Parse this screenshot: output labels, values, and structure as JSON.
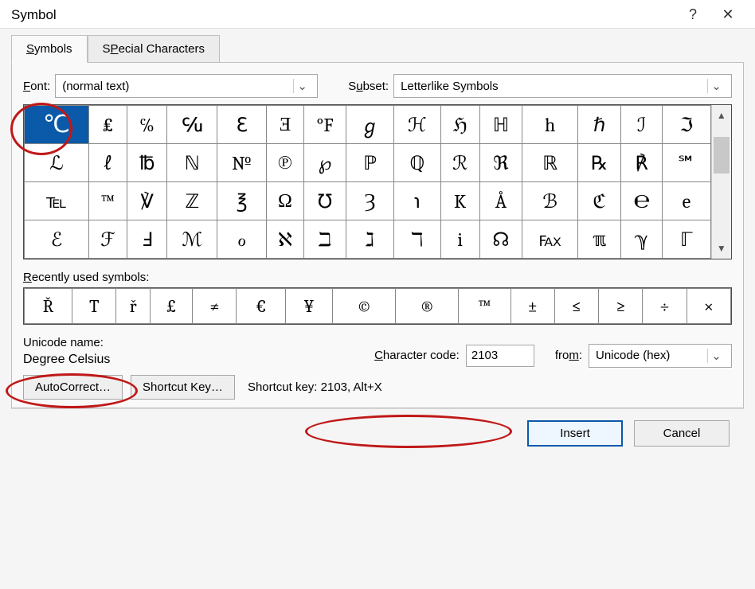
{
  "title": "Symbol",
  "help_glyph": "?",
  "close_glyph": "✕",
  "tabs": [
    {
      "label": "Symbols",
      "underline": "S",
      "rest": "ymbols",
      "active": true
    },
    {
      "label": "Special Characters",
      "underline": "P",
      "before": "S",
      "rest": "ecial Characters",
      "active": false
    }
  ],
  "font": {
    "label_before": "",
    "label_underline": "F",
    "label_after": "ont:",
    "value": "(normal text)"
  },
  "subset": {
    "label_before": "S",
    "label_underline": "u",
    "label_after": "bset:",
    "value": "Letterlike Symbols"
  },
  "grid": [
    [
      "℃",
      "₤",
      "℅",
      "℆",
      "ℇ",
      "Ǝ",
      "°F",
      "ℊ",
      "ℋ",
      "ℌ",
      "ℍ",
      "h",
      "ℏ",
      "ℐ",
      "ℑ"
    ],
    [
      "ℒ",
      "ℓ",
      "℔",
      "ℕ",
      "№",
      "℗",
      "℘",
      "ℙ",
      "ℚ",
      "ℛ",
      "ℜ",
      "ℝ",
      "℞",
      "℟",
      "℠"
    ],
    [
      "℡",
      "™",
      "℣",
      "ℤ",
      "℥",
      "Ω",
      "℧",
      "Ȝ",
      "℩",
      "K",
      "Å",
      "ℬ",
      "ℭ",
      "℮",
      "e"
    ],
    [
      "ℰ",
      "ℱ",
      "Ⅎ",
      "ℳ",
      "ℴ",
      "ℵ",
      "ℶ",
      "ℷ",
      "ℸ",
      "i",
      "☊",
      "℻",
      "ℼ",
      "ℽ",
      "ℾ"
    ]
  ],
  "selected": {
    "row": 0,
    "col": 0
  },
  "recent": {
    "label_underline": "R",
    "label_rest": "ecently used symbols:",
    "items": [
      "Ř",
      "T",
      "ř",
      "£",
      "≠",
      "€",
      "¥",
      "©",
      "®",
      "™",
      "±",
      "≤",
      "≥",
      "÷",
      "×"
    ]
  },
  "unicode_name": {
    "label": "Unicode name:",
    "value": "Degree Celsius"
  },
  "char_code": {
    "label_underline": "C",
    "label_rest": "haracter code:",
    "value": "2103"
  },
  "from": {
    "label_before": "fro",
    "label_underline": "m",
    "label_after": ":",
    "value": "Unicode (hex)"
  },
  "autocorrect_label_u": "A",
  "autocorrect_label_rest": "utoCorrect…",
  "shortcut_btn_before": "Shortcut ",
  "shortcut_btn_u": "K",
  "shortcut_btn_after": "ey…",
  "shortcut_text": "Shortcut key: 2103, Alt+X",
  "insert_u": "I",
  "insert_rest": "nsert",
  "cancel": "Cancel",
  "chev": "⌄",
  "up": "▲",
  "down": "▼"
}
